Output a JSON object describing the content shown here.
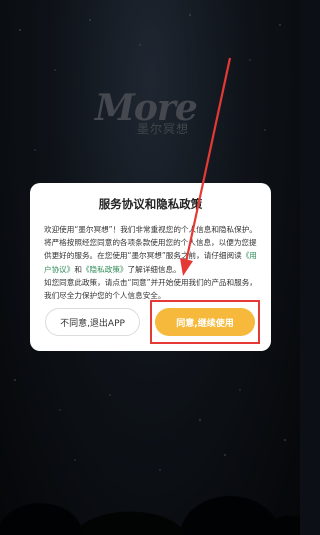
{
  "brand": {
    "word": "More",
    "sub": "墨尔冥想"
  },
  "dialog": {
    "title": "服务协议和隐私政策",
    "para1_a": "欢迎使用“墨尔冥想”！我们非常重视您的个人信息和隐私保护。将严格按照经您同意的各项条款使用您的个人信息，以便为您提供更好的服务。在您使用“墨尔冥想”服务之前，请仔细阅读",
    "link_agreement": "《用户协议》",
    "para1_and": "和",
    "link_privacy": "《隐私政策》",
    "para1_b": "了解详细信息。",
    "para2": "如您同意此政策，请点击“同意”并开始使用我们的产品和服务，我们尽全力保护您的个人信息安全。",
    "decline_label": "不同意,退出APP",
    "accept_label": "同意,继续使用"
  },
  "colors": {
    "accent": "#f6b93b",
    "link": "#2e8b57",
    "annotation": "#e53935"
  }
}
